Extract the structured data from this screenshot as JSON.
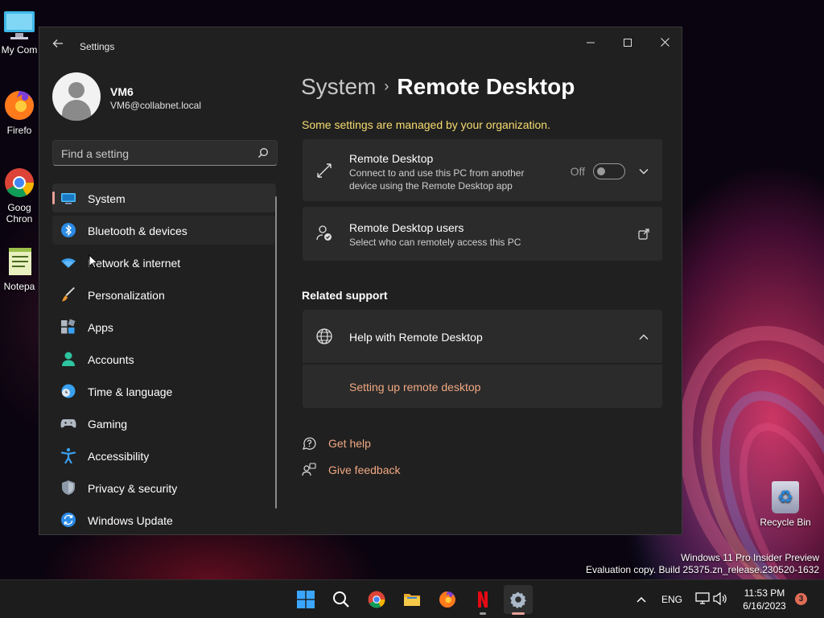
{
  "desktop": {
    "icons": [
      {
        "label": "My Com",
        "icon": "computer-icon"
      },
      {
        "label": "Firefo",
        "icon": "firefox-icon"
      },
      {
        "label": "Goog",
        "label2": "Chron",
        "icon": "chrome-icon"
      },
      {
        "label": "Notepa",
        "icon": "notepad-icon"
      }
    ],
    "recycle_bin": "Recycle Bin",
    "watermark": {
      "line1": "Windows 11 Pro Insider Preview",
      "line2": "Evaluation copy. Build 25375.zn_release.230520-1632"
    }
  },
  "window": {
    "title": "Settings",
    "controls": {
      "minimize": "─",
      "maximize": "☐",
      "close": "✕"
    }
  },
  "profile": {
    "name": "VM6",
    "email": "VM6@collabnet.local"
  },
  "search": {
    "placeholder": "Find a setting"
  },
  "nav": {
    "items": [
      {
        "label": "System",
        "icon": "system-icon",
        "state": "active"
      },
      {
        "label": "Bluetooth & devices",
        "icon": "bluetooth-icon",
        "state": "hover"
      },
      {
        "label": "Network & internet",
        "icon": "wifi-icon",
        "state": ""
      },
      {
        "label": "Personalization",
        "icon": "brush-icon",
        "state": ""
      },
      {
        "label": "Apps",
        "icon": "apps-icon",
        "state": ""
      },
      {
        "label": "Accounts",
        "icon": "accounts-icon",
        "state": ""
      },
      {
        "label": "Time & language",
        "icon": "globe-clock-icon",
        "state": ""
      },
      {
        "label": "Gaming",
        "icon": "gamepad-icon",
        "state": ""
      },
      {
        "label": "Accessibility",
        "icon": "accessibility-icon",
        "state": ""
      },
      {
        "label": "Privacy & security",
        "icon": "shield-icon",
        "state": ""
      },
      {
        "label": "Windows Update",
        "icon": "update-icon",
        "state": ""
      }
    ]
  },
  "content": {
    "breadcrumb_parent": "System",
    "breadcrumb_sep": "›",
    "breadcrumb_current": "Remote Desktop",
    "org_note": "Some settings are managed by your organization.",
    "remote_desktop": {
      "title": "Remote Desktop",
      "desc": "Connect to and use this PC from another device using the Remote Desktop app",
      "toggle_label": "Off",
      "toggle_on": false
    },
    "remote_users": {
      "title": "Remote Desktop users",
      "desc": "Select who can remotely access this PC"
    },
    "related_support": "Related support",
    "help_card": {
      "title": "Help with Remote Desktop",
      "link": "Setting up remote desktop"
    },
    "get_help": "Get help",
    "give_feedback": "Give feedback"
  },
  "taskbar": {
    "apps": [
      "start-icon",
      "search-icon",
      "chrome-icon",
      "file-explorer-icon",
      "firefox-icon",
      "netflix-icon",
      "settings-icon"
    ],
    "language": "ENG",
    "time": "11:53 PM",
    "date": "6/16/2023",
    "notifications": "3"
  },
  "colors": {
    "accent": "#e8a099",
    "link": "#f0a882",
    "warning_text": "#f7dc6f",
    "window_bg": "#202020",
    "card_bg": "#2b2b2b"
  }
}
